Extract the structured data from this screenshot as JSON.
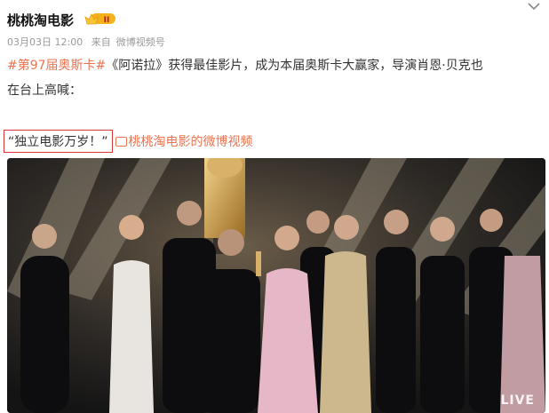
{
  "post": {
    "author": "桃桃淘电影",
    "timestamp": "03月03日 12:00",
    "source_prefix": "来自",
    "source": "微博视频号",
    "hashtag": "#第97届奥斯卡#",
    "line1_rest": "《阿诺拉》获得最佳影片，成为本届奥斯卡大赢家，导演肖恩·贝克也",
    "line2": "在台上高喊：",
    "quote": "“独立电影万岁！”",
    "video_link": "桃桃淘电影的微博视频"
  },
  "video": {
    "live_label": "LIVE"
  },
  "icons": {
    "badge": "crown-level-badge",
    "menu": "chevron-down-icon",
    "link": "video-link-icon"
  },
  "colors": {
    "accent": "#eb7350",
    "highlight_box": "#e0363b"
  }
}
